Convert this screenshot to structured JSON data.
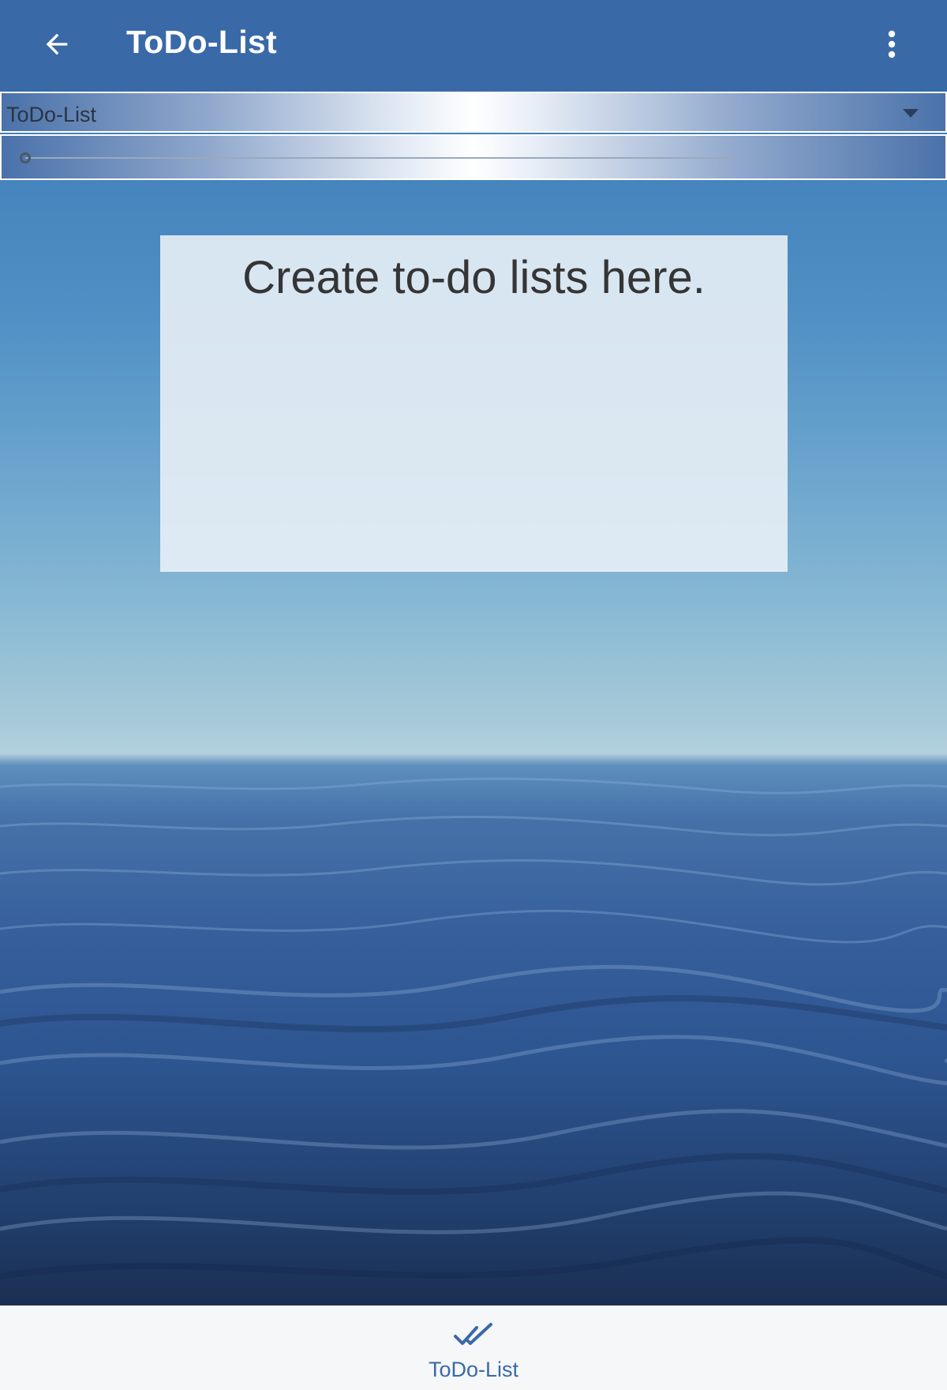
{
  "app_bar": {
    "title": "ToDo-List",
    "back_icon": "arrow-back-icon",
    "menu_icon": "more-vert-icon"
  },
  "selector": {
    "value": "ToDo-List",
    "icon": "caret-down-icon"
  },
  "slider": {
    "value": 0
  },
  "card": {
    "text": "Create to-do lists here."
  },
  "bottom_nav": {
    "items": [
      {
        "label": "ToDo-List",
        "icon": "double-check-icon",
        "selected": true
      }
    ]
  },
  "colors": {
    "primary": "#3a69a8",
    "card_text": "#353535",
    "nav_background": "#f6f7f9"
  }
}
